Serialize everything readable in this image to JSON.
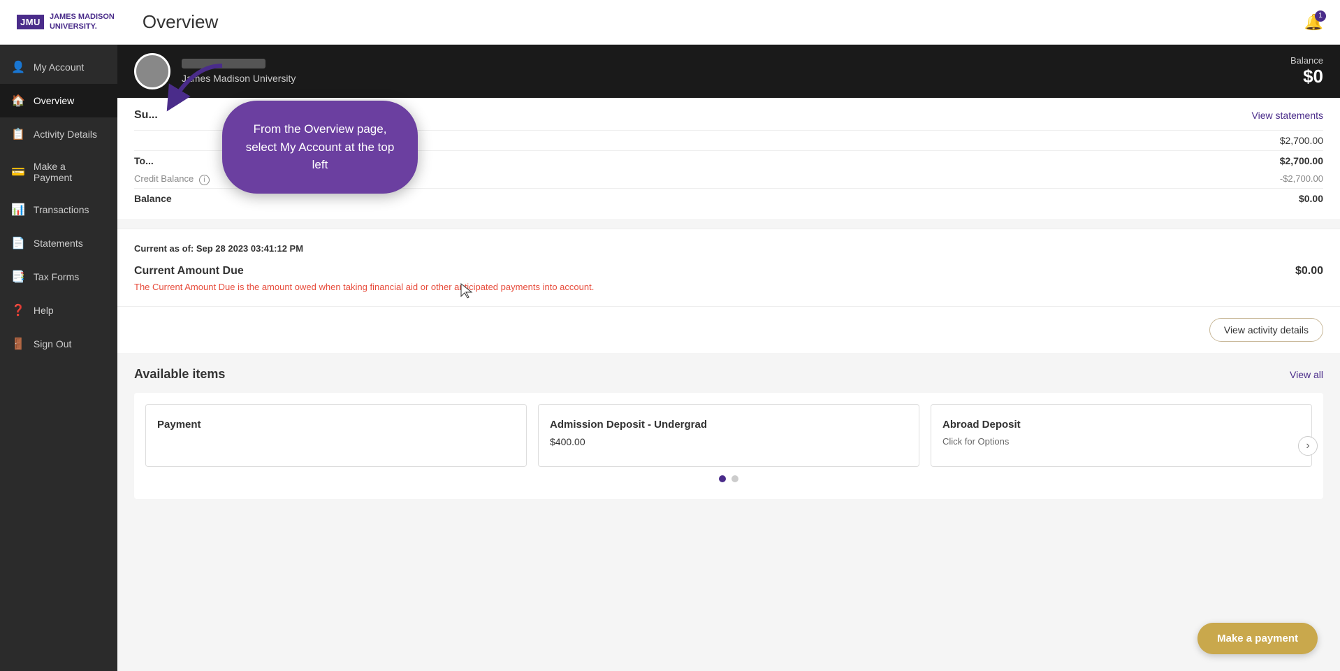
{
  "header": {
    "title": "Overview",
    "logo_text": "JMU",
    "logo_subtext": "JAMES MADISON\nUNIVERSITY.",
    "notification_count": "1"
  },
  "sidebar": {
    "items": [
      {
        "id": "my-account",
        "label": "My Account",
        "icon": "👤"
      },
      {
        "id": "overview",
        "label": "Overview",
        "icon": "🏠",
        "active": true
      },
      {
        "id": "activity-details",
        "label": "Activity Details",
        "icon": "📋"
      },
      {
        "id": "make-payment",
        "label": "Make a Payment",
        "icon": "💳"
      },
      {
        "id": "transactions",
        "label": "Transactions",
        "icon": "📊"
      },
      {
        "id": "statements",
        "label": "Statements",
        "icon": "📄"
      },
      {
        "id": "tax-forms",
        "label": "Tax Forms",
        "icon": "📑"
      },
      {
        "id": "help",
        "label": "Help",
        "icon": "❓"
      },
      {
        "id": "sign-out",
        "label": "Sign Out",
        "icon": "🚪"
      }
    ]
  },
  "user_bar": {
    "university": "James Madison University",
    "balance_label": "Balance",
    "balance_amount": "$0"
  },
  "account_summary": {
    "title": "Su...",
    "view_statements": "View statements",
    "rows": [
      {
        "label": "",
        "amount": "$2,700.00",
        "type": "plain"
      },
      {
        "label": "To...",
        "amount": "$2,700.00",
        "type": "total"
      },
      {
        "label": "Credit Balance",
        "amount": "-$2,700.00",
        "type": "credit"
      },
      {
        "label": "Balance",
        "amount": "$0.00",
        "type": "balance"
      }
    ]
  },
  "current_due": {
    "date_label": "Current as of: Sep 28 2023 03:41:12 PM",
    "amount_due_label": "Current Amount Due",
    "amount_due_value": "$0.00",
    "description": "The Current Amount Due is the amount owed when taking financial aid or other anticipated payments into account."
  },
  "activity_btn": {
    "label": "View activity details"
  },
  "available_items": {
    "title": "Available items",
    "view_all": "View all",
    "items": [
      {
        "id": "payment",
        "title": "Payment",
        "amount": "",
        "sub": ""
      },
      {
        "id": "admission-deposit",
        "title": "Admission Deposit - Undergrad",
        "amount": "$400.00",
        "sub": ""
      },
      {
        "id": "abroad-deposit",
        "title": "Abroad Deposit",
        "amount": "",
        "sub": "Click for Options"
      }
    ],
    "dots": [
      true,
      false
    ]
  },
  "callout": {
    "text": "From the Overview page, select My Account at the top left"
  },
  "fab": {
    "label": "Make a payment"
  }
}
